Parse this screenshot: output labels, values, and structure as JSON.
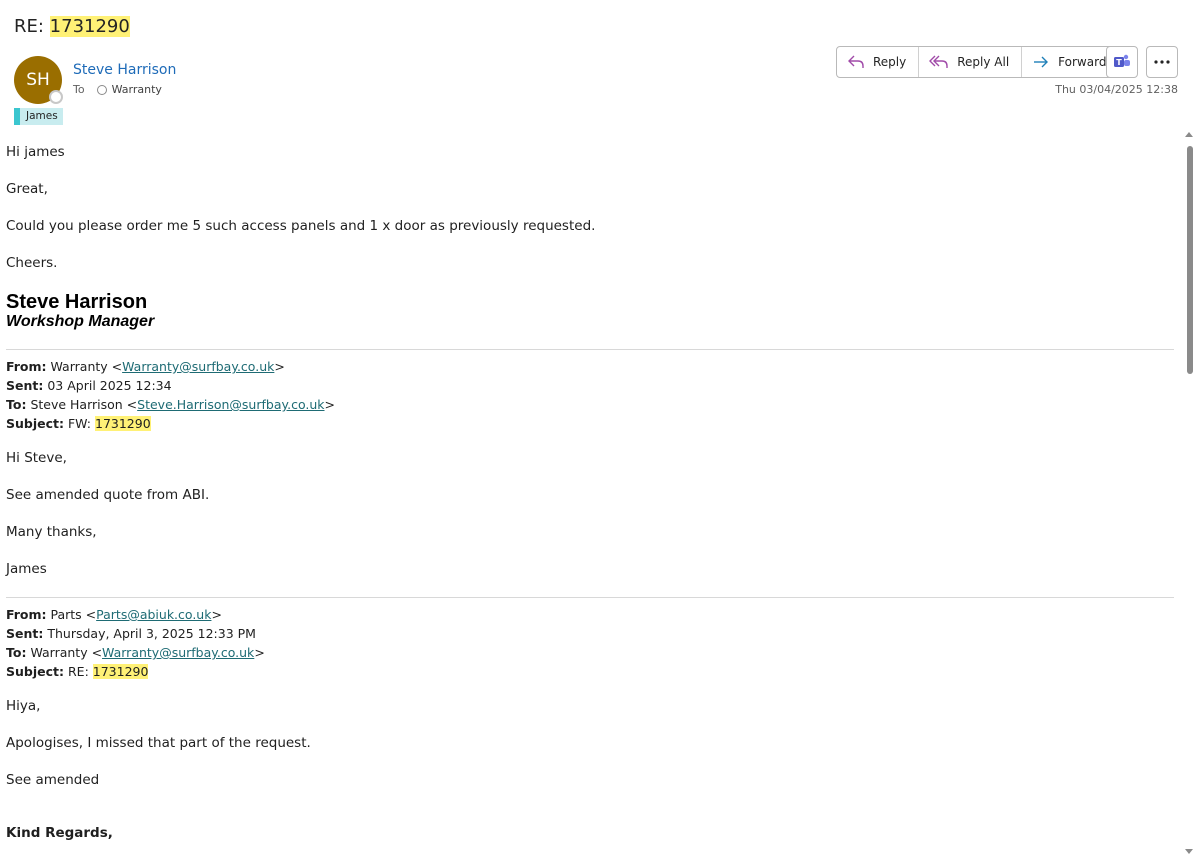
{
  "header": {
    "subject_prefix": "RE: ",
    "subject_number": "1731290",
    "avatar_initials": "SH",
    "sender_name": "Steve Harrison",
    "to_label": "To",
    "to_recipient": "Warranty",
    "category_tag": "James",
    "date": "Thu 03/04/2025 12:38"
  },
  "actions": {
    "reply": "Reply",
    "reply_all": "Reply All",
    "forward": "Forward"
  },
  "message": {
    "p1": "Hi james",
    "p2": "Great,",
    "p3": "Could you please order me 5 such access panels and 1 x door as previously requested.",
    "p4": "Cheers.",
    "sig_name": "Steve Harrison",
    "sig_title": "Workshop Manager"
  },
  "quote1": {
    "from_label": "From:",
    "from_name": "Warranty <",
    "from_email": "Warranty@surfbay.co.uk",
    "from_close": ">",
    "sent_label": "Sent:",
    "sent_value": "03 April 2025 12:34",
    "to_label": "To:",
    "to_name": "Steve Harrison <",
    "to_email": "Steve.Harrison@surfbay.co.uk",
    "to_close": ">",
    "subject_label": "Subject:",
    "subject_prefix": "FW: ",
    "subject_number": "1731290",
    "p1": "Hi Steve,",
    "p2": "See amended quote from ABI.",
    "p3": "Many thanks,",
    "p4": "James"
  },
  "quote2": {
    "from_label": "From:",
    "from_name": "Parts <",
    "from_email": "Parts@abiuk.co.uk",
    "from_close": ">",
    "sent_label": "Sent:",
    "sent_value": "Thursday, April 3, 2025 12:33 PM",
    "to_label": "To:",
    "to_name": "Warranty <",
    "to_email": "Warranty@surfbay.co.uk",
    "to_close": ">",
    "subject_label": "Subject:",
    "subject_prefix": "RE: ",
    "subject_number": "1731290",
    "p1": "Hiya,",
    "p2": "Apologises, I missed that part of the request.",
    "p3": "See amended",
    "p4": "Kind Regards,"
  },
  "colors": {
    "avatar": "#9a6e00",
    "highlight": "#fff176",
    "link": "#1e6b74",
    "sender": "#1e6bb8",
    "category": "#3bc6cf"
  },
  "icons": [
    "reply-icon",
    "reply-all-icon",
    "forward-icon",
    "teams-icon",
    "more-icon"
  ]
}
